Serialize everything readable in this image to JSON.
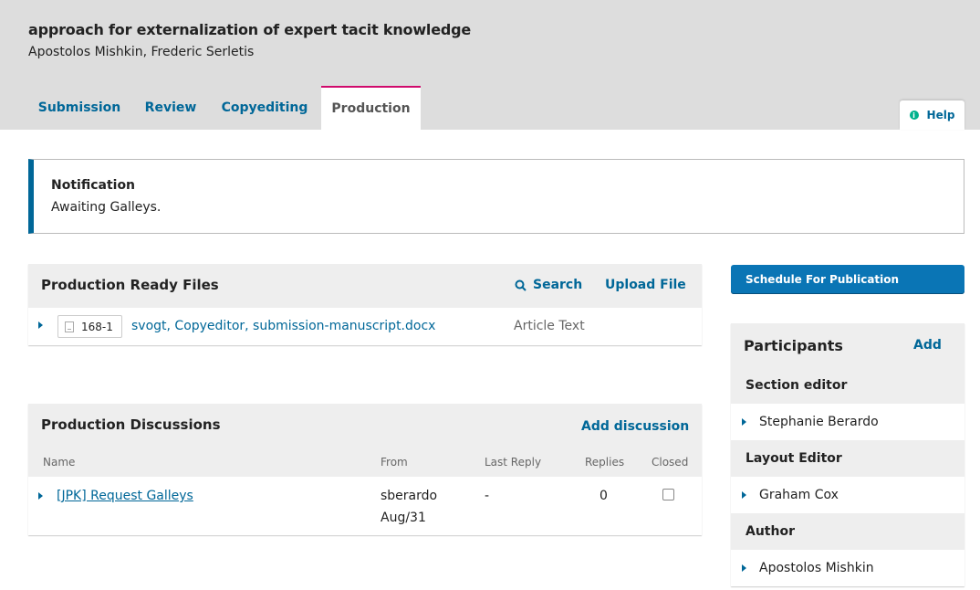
{
  "header": {
    "title": "approach for externalization of expert tacit knowledge",
    "authors": "Apostolos Mishkin, Frederic Serletis"
  },
  "tabs": [
    {
      "label": "Submission"
    },
    {
      "label": "Review"
    },
    {
      "label": "Copyediting"
    },
    {
      "label": "Production",
      "active": true
    }
  ],
  "help": {
    "label": "Help",
    "icon": "info-icon"
  },
  "notification": {
    "title": "Notification",
    "text": "Awaiting Galleys."
  },
  "production_files": {
    "title": "Production Ready Files",
    "search_label": "Search",
    "upload_label": "Upload File",
    "files": [
      {
        "id": "168-1",
        "name": "svogt, Copyeditor, submission-manuscript.docx",
        "type": "Article Text"
      }
    ]
  },
  "discussions": {
    "title": "Production Discussions",
    "add_label": "Add discussion",
    "columns": [
      "Name",
      "From",
      "Last Reply",
      "Replies",
      "Closed"
    ],
    "rows": [
      {
        "name": "[JPK] Request Galleys",
        "from": "sberardo",
        "date": "Aug/31",
        "last_reply": "-",
        "replies": "0",
        "closed": false
      }
    ]
  },
  "schedule_button": "Schedule For Publication",
  "participants": {
    "title": "Participants",
    "add_label": "Add",
    "groups": [
      {
        "role": "Section editor",
        "people": [
          "Stephanie Berardo"
        ]
      },
      {
        "role": "Layout Editor",
        "people": [
          "Graham Cox"
        ]
      },
      {
        "role": "Author",
        "people": [
          "Apostolos Mishkin"
        ]
      }
    ]
  },
  "colors": {
    "accent": "#006798",
    "active_tab": "#d00a6c",
    "primary_button": "#0a75b5"
  }
}
